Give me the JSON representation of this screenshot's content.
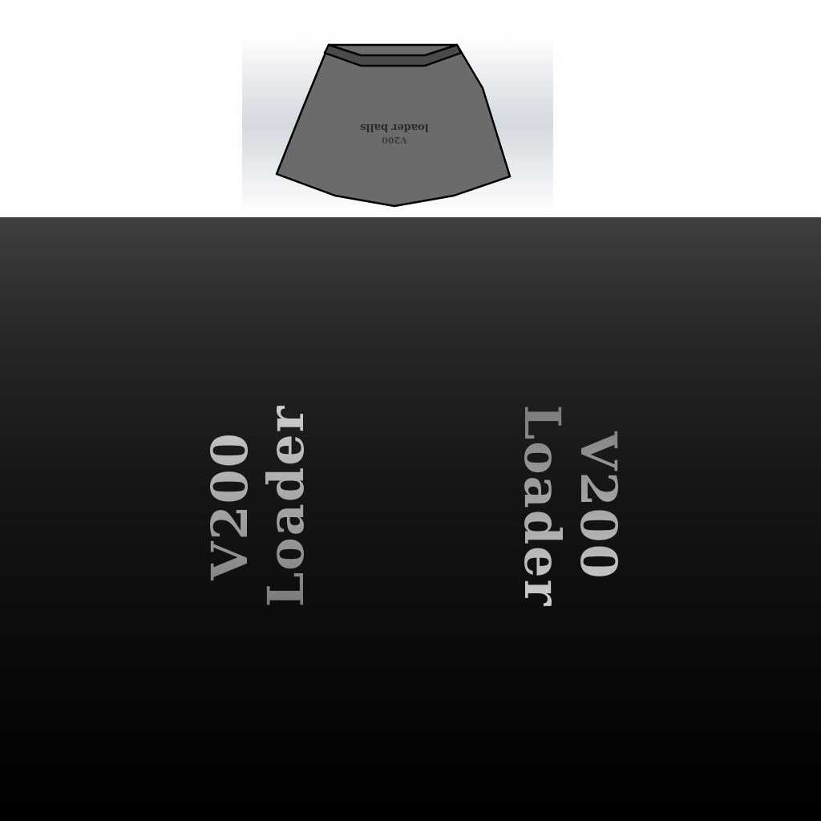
{
  "preview": {
    "line1": "loader balls",
    "line2": "V200"
  },
  "texture": {
    "left_label": {
      "line1": "V200",
      "line2": "Loader"
    },
    "right_label": {
      "line1": "V200",
      "line2": "Loader"
    }
  },
  "colors": {
    "shape_fill": "#6b6b6b",
    "shape_top_band": "#4a4a4a",
    "shape_outline": "#000000",
    "preview_text": "#2a2a2a",
    "texture_top": "#3f3f3f",
    "texture_bottom": "#000000"
  }
}
